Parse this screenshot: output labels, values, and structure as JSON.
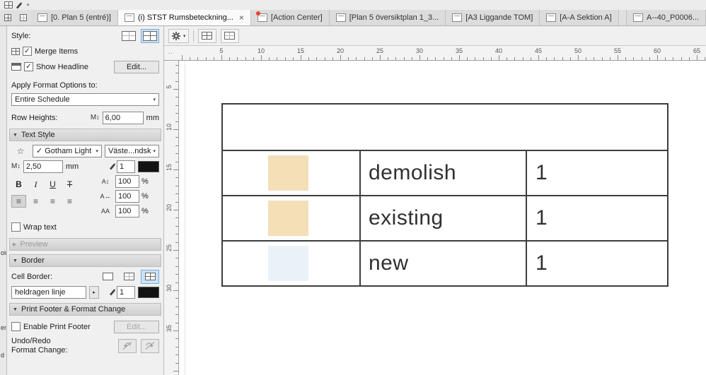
{
  "titlebar": {
    "icons": [
      "window-grid-icon",
      "edit-icon",
      "add-icon"
    ]
  },
  "tab_bar": {
    "tabs": [
      {
        "label": "[0. Plan 5 (entré)]",
        "icon": "floor-plan-icon",
        "active": false
      },
      {
        "label": "(i) STST Rumsbeteckning...",
        "icon": "schedule-icon",
        "active": true
      },
      {
        "label": "[Action Center]",
        "icon": "action-center-icon",
        "notification": true
      },
      {
        "label": "[Plan 5  översiktplan 1_3...",
        "icon": "floor-plan-icon"
      },
      {
        "label": "[A3 Liggande TOM]",
        "icon": "layout-icon"
      },
      {
        "label": "[A-A Sektion A]",
        "icon": "section-icon"
      },
      {
        "label": "A--40_P0006...",
        "icon": "drawing-icon",
        "last": true
      }
    ]
  },
  "edge_strip": {
    "fragments": [
      "oint",
      "ent",
      "d"
    ]
  },
  "panel": {
    "style_label": "Style:",
    "merge_items_label": "Merge Items",
    "show_headline_label": "Show Headline",
    "edit_label": "Edit...",
    "apply_format_label": "Apply Format Options to:",
    "apply_format_value": "Entire Schedule",
    "row_heights_label": "Row Heights:",
    "row_height_value": "6,00",
    "unit_mm": "mm",
    "section_text_style": "Text Style",
    "font_value": "Gotham Light",
    "language_value": "Väste...ndsk",
    "text_size_value": "2,50",
    "text_pen_value": "1",
    "bold": "B",
    "italic": "I",
    "underline": "U",
    "strike": "T",
    "line_spacing_value": "100",
    "char_spacing_value": "100",
    "superscript_value": "100",
    "percent": "%",
    "wrap_text_label": "Wrap text",
    "section_preview": "Preview",
    "section_border": "Border",
    "cell_border_label": "Cell Border:",
    "border_style_value": "heldragen linje",
    "border_pen_value": "1",
    "section_print_footer": "Print Footer & Format Change",
    "enable_print_footer_label": "Enable Print Footer",
    "edit2_label": "Edit...",
    "undo_line1": "Undo/Redo",
    "undo_line2": "Format Change:"
  },
  "rulers": {
    "corner": "..",
    "horizontal": [
      5,
      10,
      15,
      20,
      25,
      30,
      35,
      40,
      45,
      50,
      55,
      60,
      65
    ],
    "vertical": [
      5,
      10,
      15,
      20,
      25,
      30,
      35
    ]
  },
  "schedule": {
    "rows": [
      {
        "color": "#f4dfb6",
        "name": "demolish",
        "count": "1"
      },
      {
        "color": "#f4dfb6",
        "name": "existing",
        "count": "1"
      },
      {
        "color": "#eaf2f8",
        "name": "new",
        "count": "1"
      }
    ]
  },
  "icons": {
    "check": "✓",
    "star": "☆",
    "letter_m": "M",
    "updown": "↕",
    "chevron_down": "▾",
    "tri_open": "▼",
    "tri_closed": "▶",
    "tri_right": "▸",
    "close": "×",
    "align": "≡",
    "undo": "↶",
    "redo": "↷",
    "line_spacing": "A↕",
    "char_spacing": "A↔",
    "super_text": "AA",
    "plus": "+"
  },
  "colors": {
    "selection": "#cbe2f6",
    "table_border": "#3d3d3d"
  }
}
